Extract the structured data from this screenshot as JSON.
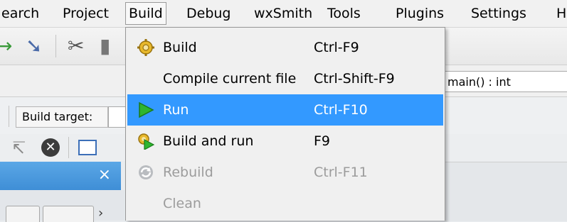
{
  "menubar": {
    "items": [
      "earch",
      "Project",
      "Build",
      "Debug",
      "wxSmith",
      "Tools",
      "Plugins",
      "Settings",
      "H"
    ],
    "open_item": "Build"
  },
  "toolbar": {
    "icons": [
      "redo-arrow-icon",
      "undo-arrow-icon",
      "cut-icon",
      "copy-icon"
    ]
  },
  "function_selector": {
    "value": "main() : int"
  },
  "build_target": {
    "label": "Build target:"
  },
  "side_panel": {
    "close": "×"
  },
  "build_menu": {
    "items": [
      {
        "label": "Build",
        "shortcut": "Ctrl-F9",
        "icon": "gear-icon",
        "state": "normal"
      },
      {
        "label": "Compile current file",
        "shortcut": "Ctrl-Shift-F9",
        "icon": "",
        "state": "normal"
      },
      {
        "label": "Run",
        "shortcut": "Ctrl-F10",
        "icon": "play-icon",
        "state": "highlighted"
      },
      {
        "label": "Build and run",
        "shortcut": "F9",
        "icon": "gear-play-icon",
        "state": "normal"
      },
      {
        "label": "Rebuild",
        "shortcut": "Ctrl-F11",
        "icon": "rebuild-icon",
        "state": "disabled"
      },
      {
        "label": "Clean",
        "shortcut": "",
        "icon": "",
        "state": "disabled"
      }
    ]
  },
  "colors": {
    "highlight": "#3399ff",
    "panel_title": "#4a9be0",
    "disabled_text": "#9c9c9c"
  }
}
